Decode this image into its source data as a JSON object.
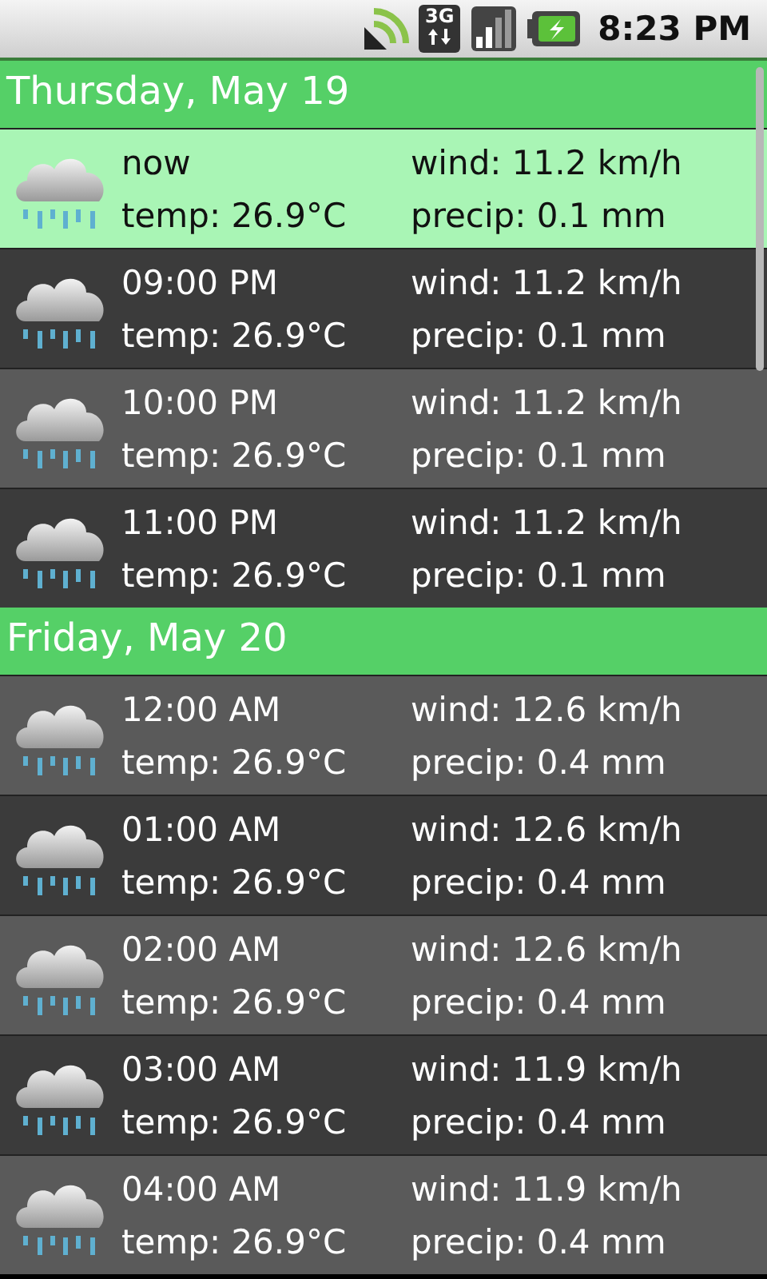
{
  "status_bar": {
    "network_type": "3G",
    "time": "8:23 PM"
  },
  "days": [
    {
      "title": "Thursday, May 19",
      "hours": [
        {
          "time": "now",
          "temp": "temp: 26.9°C",
          "wind": "wind: 11.2 km/h",
          "precip": "precip: 0.1 mm",
          "selected": true
        },
        {
          "time": "09:00 PM",
          "temp": "temp: 26.9°C",
          "wind": "wind: 11.2 km/h",
          "precip": "precip: 0.1 mm",
          "selected": false
        },
        {
          "time": "10:00 PM",
          "temp": "temp: 26.9°C",
          "wind": "wind: 11.2 km/h",
          "precip": "precip: 0.1 mm",
          "selected": false
        },
        {
          "time": "11:00 PM",
          "temp": "temp: 26.9°C",
          "wind": "wind: 11.2 km/h",
          "precip": "precip: 0.1 mm",
          "selected": false
        }
      ]
    },
    {
      "title": "Friday, May 20",
      "hours": [
        {
          "time": "12:00 AM",
          "temp": "temp: 26.9°C",
          "wind": "wind: 12.6 km/h",
          "precip": "precip: 0.4 mm",
          "selected": false
        },
        {
          "time": "01:00 AM",
          "temp": "temp: 26.9°C",
          "wind": "wind: 12.6 km/h",
          "precip": "precip: 0.4 mm",
          "selected": false
        },
        {
          "time": "02:00 AM",
          "temp": "temp: 26.9°C",
          "wind": "wind: 12.6 km/h",
          "precip": "precip: 0.4 mm",
          "selected": false
        },
        {
          "time": "03:00 AM",
          "temp": "temp: 26.9°C",
          "wind": "wind: 11.9 km/h",
          "precip": "precip: 0.4 mm",
          "selected": false
        },
        {
          "time": "04:00 AM",
          "temp": "temp: 26.9°C",
          "wind": "wind: 11.9 km/h",
          "precip": "precip: 0.4 mm",
          "selected": false
        }
      ]
    }
  ]
}
